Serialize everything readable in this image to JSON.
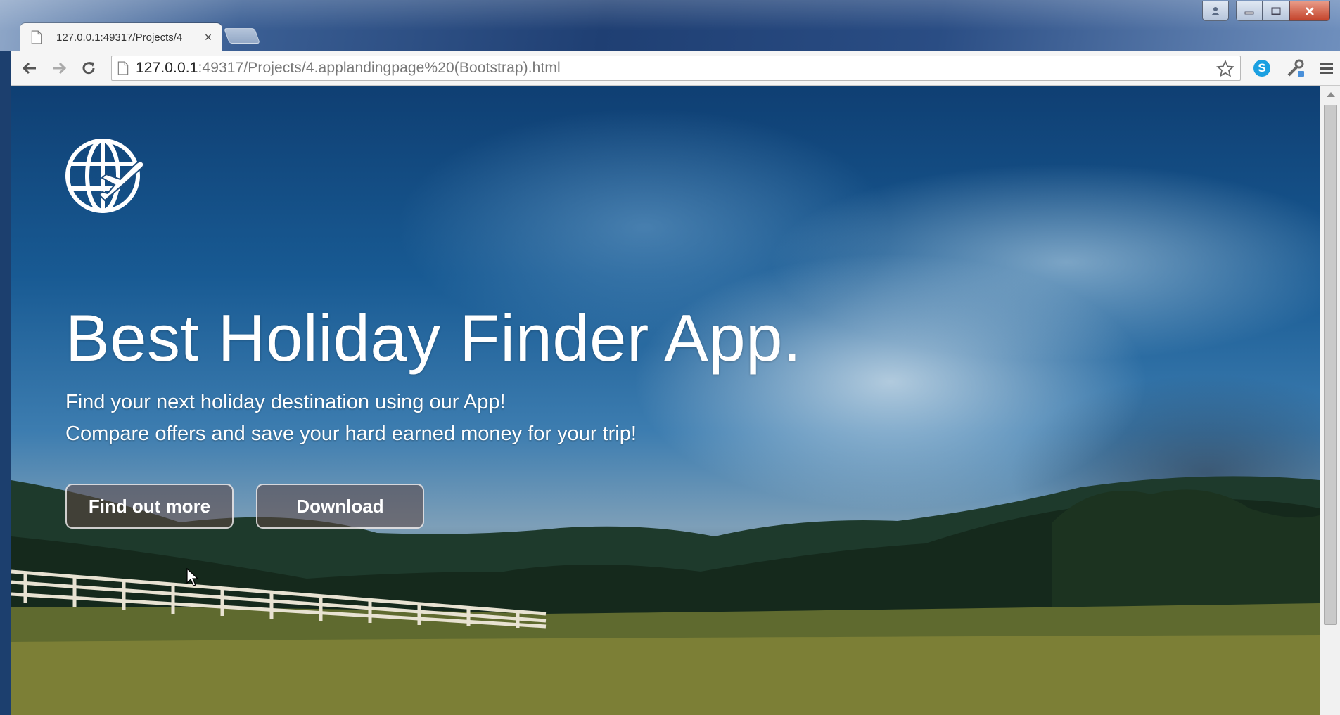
{
  "browser": {
    "tab_title": "127.0.0.1:49317/Projects/4",
    "tab_close": "×",
    "url_host": "127.0.0.1",
    "url_rest": ":49317/Projects/4.applandingpage%20(Bootstrap).html"
  },
  "page": {
    "hero_title": "Best Holiday Finder App.",
    "subtitle_line1": "Find your next holiday destination using our App!",
    "subtitle_line2": "Compare offers and save your hard earned money for your trip!",
    "button_more": "Find out more",
    "button_download": "Download"
  },
  "icons": [
    "page-icon",
    "back-arrow-icon",
    "forward-arrow-icon",
    "reload-icon",
    "star-icon",
    "skype-icon",
    "tools-icon",
    "menu-icon",
    "globe-airplane-logo-icon",
    "mouse-cursor-icon"
  ],
  "colors": {
    "close_button": "#c4432b",
    "skype": "#1ba0e1",
    "sky_dark": "#0f3f73"
  }
}
